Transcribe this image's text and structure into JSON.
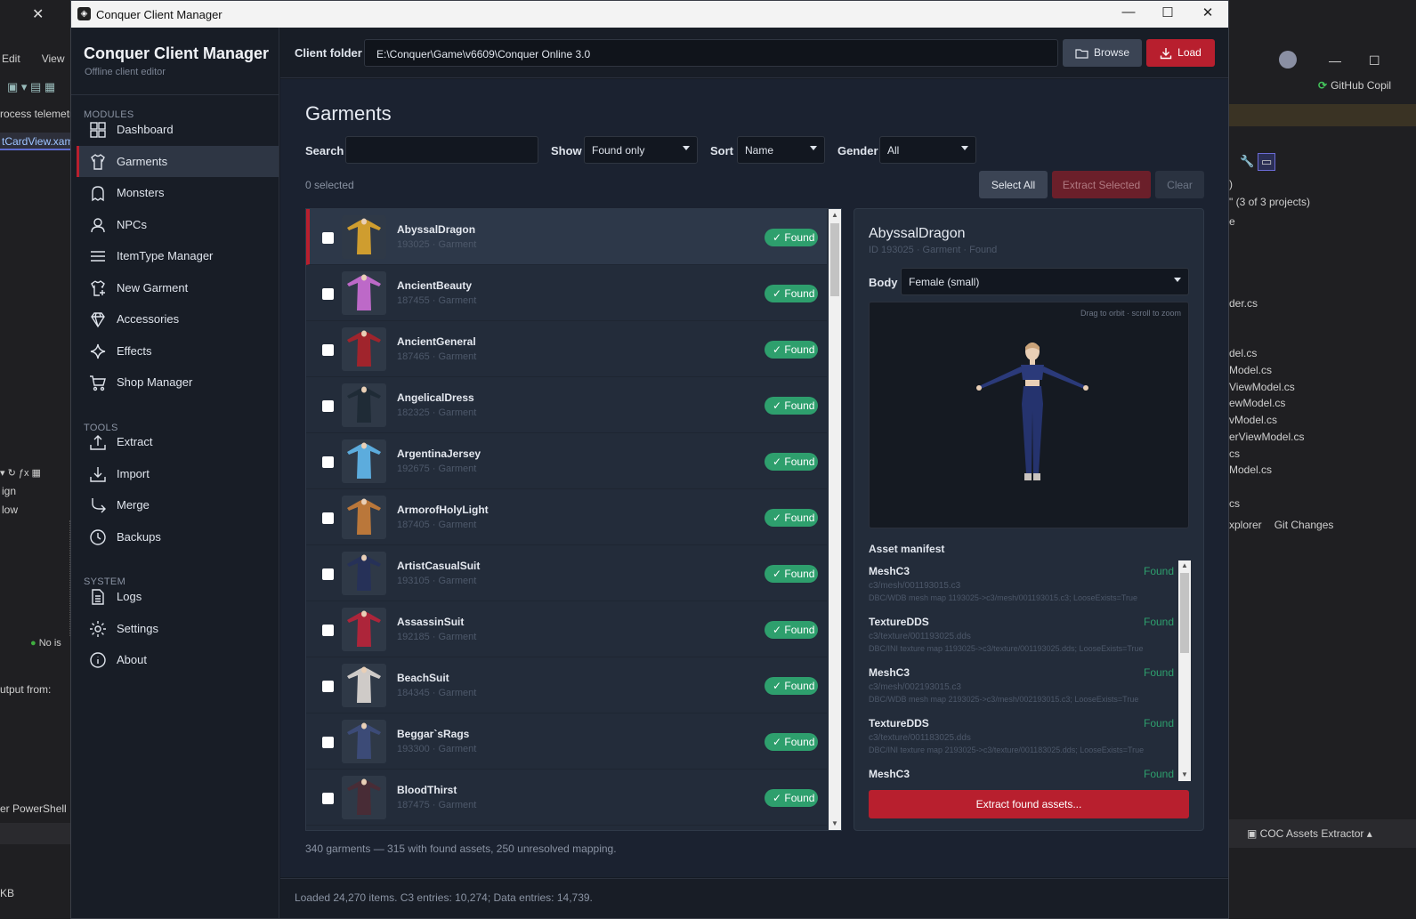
{
  "ide": {
    "close_glyph": "✕",
    "menu": [
      "Edit",
      "View"
    ],
    "left_texts": [
      "rocess telemetr",
      "tCardView.xam",
      "ign",
      "low",
      "No is",
      "utput from:",
      "er PowerShell",
      "KB"
    ],
    "right_project_count": "\" (3 of 3 projects)",
    "right_files": [
      "der.cs",
      "del.cs",
      "Model.cs",
      "ViewModel.cs",
      "ewModel.cs",
      "vModel.cs",
      "erViewModel.cs",
      "cs",
      "Model.cs",
      "cs"
    ],
    "right_tabs": [
      "xplorer",
      "Git Changes"
    ],
    "copilot_label": "GitHub Copil",
    "extractor_label": "COC Assets Extractor",
    "brace_text": ")",
    "e_text": "e"
  },
  "window": {
    "title": "Conquer Client Manager",
    "minimize": "—",
    "maximize": "☐",
    "close": "✕"
  },
  "sidebar": {
    "brand": "Conquer Client Manager",
    "subtitle": "Offline client editor",
    "sections": {
      "modules": "MODULES",
      "tools": "TOOLS",
      "system": "SYSTEM"
    },
    "modules": [
      {
        "label": "Dashboard",
        "icon": "dashboard-icon"
      },
      {
        "label": "Garments",
        "icon": "shirt-icon"
      },
      {
        "label": "Monsters",
        "icon": "ghost-icon"
      },
      {
        "label": "NPCs",
        "icon": "person-icon"
      },
      {
        "label": "ItemType Manager",
        "icon": "list-icon"
      },
      {
        "label": "New Garment",
        "icon": "shirt-plus-icon"
      },
      {
        "label": "Accessories",
        "icon": "gem-icon"
      },
      {
        "label": "Effects",
        "icon": "sparkle-icon"
      },
      {
        "label": "Shop Manager",
        "icon": "cart-icon"
      }
    ],
    "tools": [
      {
        "label": "Extract",
        "icon": "upload-icon"
      },
      {
        "label": "Import",
        "icon": "download-icon"
      },
      {
        "label": "Merge",
        "icon": "merge-icon"
      },
      {
        "label": "Backups",
        "icon": "clock-icon"
      }
    ],
    "system": [
      {
        "label": "Logs",
        "icon": "document-icon"
      },
      {
        "label": "Settings",
        "icon": "gear-icon"
      },
      {
        "label": "About",
        "icon": "info-icon"
      }
    ]
  },
  "topbar": {
    "client_folder_label": "Client folder",
    "client_folder_value": "E:\\Conquer\\Game\\v6609\\Conquer Online 3.0",
    "browse_label": "Browse",
    "load_label": "Load"
  },
  "page": {
    "title": "Garments",
    "search_label": "Search",
    "search_value": "",
    "show_label": "Show",
    "show_value": "Found only",
    "sort_label": "Sort",
    "sort_value": "Name",
    "gender_label": "Gender",
    "gender_value": "All",
    "selected_count": "0 selected",
    "select_all": "Select All",
    "extract_selected": "Extract Selected",
    "clear": "Clear",
    "summary": "340 garments — 315 with found assets, 250 unresolved mapping."
  },
  "garments": [
    {
      "name": "AbyssalDragon",
      "sub": "193025 · Garment",
      "status": "✓ Found",
      "color": "#d8a22e",
      "selected": true
    },
    {
      "name": "AncientBeauty",
      "sub": "187455 · Garment",
      "status": "✓ Found",
      "color": "#c56bd0",
      "selected": false
    },
    {
      "name": "AncientGeneral",
      "sub": "187465 · Garment",
      "status": "✓ Found",
      "color": "#a7232b",
      "selected": false
    },
    {
      "name": "AngelicalDress",
      "sub": "182325 · Garment",
      "status": "✓ Found",
      "color": "#1f2a36",
      "selected": false
    },
    {
      "name": "ArgentinaJersey",
      "sub": "192675 · Garment",
      "status": "✓ Found",
      "color": "#5fb2e6",
      "selected": false
    },
    {
      "name": "ArmorofHolyLight",
      "sub": "187405 · Garment",
      "status": "✓ Found",
      "color": "#c27a3a",
      "selected": false
    },
    {
      "name": "ArtistCasualSuit",
      "sub": "193105 · Garment",
      "status": "✓ Found",
      "color": "#26305a",
      "selected": false
    },
    {
      "name": "AssassinSuit",
      "sub": "192185 · Garment",
      "status": "✓ Found",
      "color": "#b4243a",
      "selected": false
    },
    {
      "name": "BeachSuit",
      "sub": "184345 · Garment",
      "status": "✓ Found",
      "color": "#d8d3d0",
      "selected": false
    },
    {
      "name": "Beggar`sRags",
      "sub": "193300 · Garment",
      "status": "✓ Found",
      "color": "#3d4c7a",
      "selected": false
    },
    {
      "name": "BloodThirst",
      "sub": "187475 · Garment",
      "status": "✓ Found",
      "color": "#4a2b36",
      "selected": false
    }
  ],
  "detail": {
    "title": "AbyssalDragon",
    "sub": "ID 193025 · Garment · Found",
    "body_label": "Body",
    "body_value": "Female (small)",
    "viewer_hint": "Drag to orbit · scroll to zoom",
    "manifest_title": "Asset manifest",
    "manifest": [
      {
        "kind": "MeshC3",
        "status": "Found",
        "path": "c3/mesh/001193015.c3",
        "detail": "DBC/WDB mesh map 1193025->c3/mesh/001193015.c3; LooseExists=True"
      },
      {
        "kind": "TextureDDS",
        "status": "Found",
        "path": "c3/texture/001193025.dds",
        "detail": "DBC/INI texture map 1193025->c3/texture/001193025.dds; LooseExists=True"
      },
      {
        "kind": "MeshC3",
        "status": "Found",
        "path": "c3/mesh/002193015.c3",
        "detail": "DBC/WDB mesh map 2193025->c3/mesh/002193015.c3; LooseExists=True"
      },
      {
        "kind": "TextureDDS",
        "status": "Found",
        "path": "c3/texture/001183025.dds",
        "detail": "DBC/INI texture map 2193025->c3/texture/001183025.dds; LooseExists=True"
      },
      {
        "kind": "MeshC3",
        "status": "Found",
        "path": "",
        "detail": ""
      }
    ],
    "extract_label": "Extract found assets..."
  },
  "status": "Loaded 24,270 items. C3 entries: 10,274; Data entries: 14,739.",
  "colors": {
    "accent": "#b81f2e",
    "found": "#2e9f6d",
    "bg": "#1b2230"
  }
}
